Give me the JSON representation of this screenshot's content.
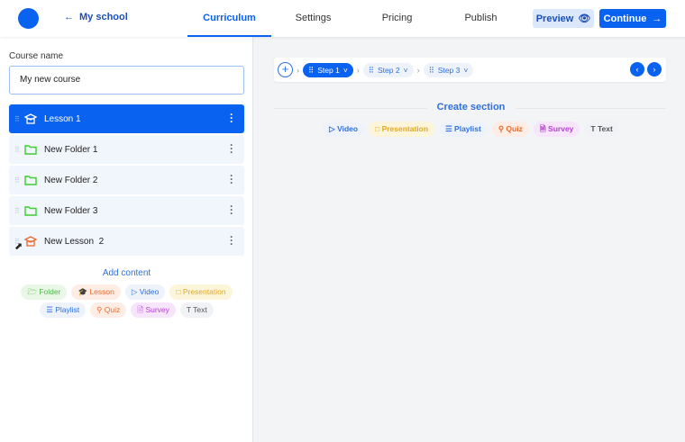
{
  "header": {
    "back_label": "My school",
    "tabs": [
      "Curriculum",
      "Settings",
      "Pricing",
      "Publish"
    ],
    "active_tab": "Curriculum",
    "preview_label": "Preview",
    "continue_label": "Continue"
  },
  "sidebar": {
    "course_name_label": "Course name",
    "course_name_value": "My new course",
    "items": [
      {
        "label": "Lesson 1",
        "type": "lesson"
      },
      {
        "label": "New Folder 1",
        "type": "folder"
      },
      {
        "label": "New Folder 2",
        "type": "folder"
      },
      {
        "label": "New Folder 3",
        "type": "folder"
      },
      {
        "label": "New Lesson  2",
        "type": "lesson"
      }
    ],
    "add_content_label": "Add content",
    "add_chips": [
      "Folder",
      "Lesson",
      "Video",
      "Presentation",
      "Playlist",
      "Quiz",
      "Survey",
      "Text"
    ]
  },
  "main": {
    "steps": [
      "Step 1",
      "Step 2",
      "Step 3"
    ],
    "active_step": "Step 1",
    "create_section_label": "Create section",
    "section_chips": [
      "Video",
      "Presentation",
      "Playlist",
      "Quiz",
      "Survey",
      "Text"
    ]
  },
  "colors": {
    "accent": "#0a62f0"
  }
}
